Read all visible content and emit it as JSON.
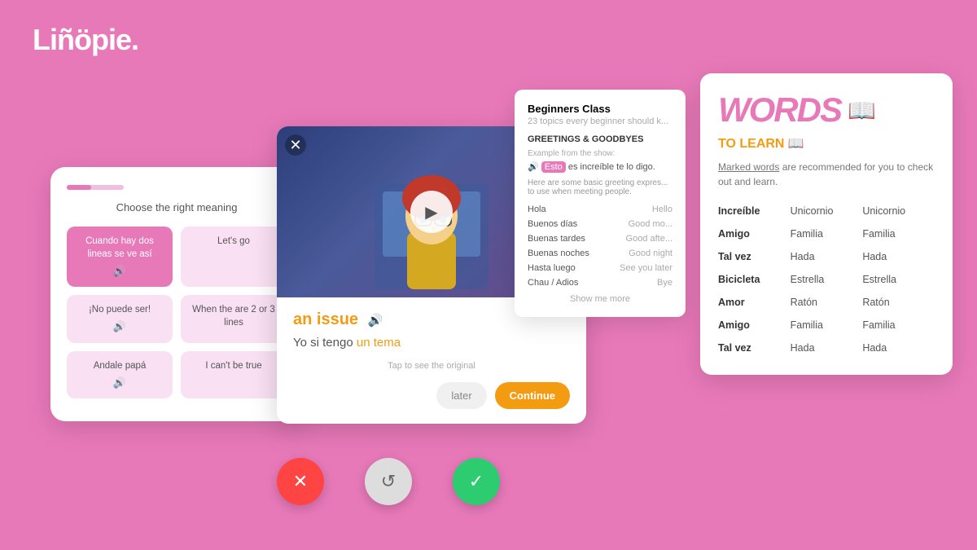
{
  "logo": {
    "text": "Liñöpie."
  },
  "quiz_card": {
    "title": "Choose the right meaning",
    "options": [
      {
        "text": "Cuando hay dos lineas se ve así",
        "highlight": true
      },
      {
        "text": "Let's go",
        "highlight": false
      },
      {
        "text": "¡No puede ser!",
        "highlight": false
      },
      {
        "text": "When the are 2 or 3 lines",
        "highlight": false
      },
      {
        "text": "Andale papá",
        "highlight": false
      },
      {
        "text": "I can't be true",
        "highlight": false
      }
    ]
  },
  "video_card": {
    "phrase": "an issue",
    "translation": "Yo si tengo",
    "translation_highlight": "un tema",
    "tap_text": "Tap to see the original",
    "btn_later": "later",
    "btn_continue": "Continue"
  },
  "vocab_list": {
    "title": "Beginners Class",
    "subtitle": "23 topics every beginner should k...",
    "section": "GREETINGS & GOODBYES",
    "example_label": "Example from the show:",
    "sentence_plain": "es increíble te lo digo.",
    "sentence_highlight": "Esto",
    "desc": "Here are some basic greeting expres... to use when meeting people.",
    "pairs": [
      {
        "es": "Hola",
        "en": "Hello"
      },
      {
        "es": "Buenos días",
        "en": "Good mo..."
      },
      {
        "es": "Buenas tardes",
        "en": "Good afte..."
      },
      {
        "es": "Buenas noches",
        "en": "Good night"
      },
      {
        "es": "Hasta luego",
        "en": "See you later"
      },
      {
        "es": "Chau / Adios",
        "en": "Bye"
      }
    ],
    "more": "Show me more"
  },
  "words_card": {
    "title_words": "WORDS",
    "subtitle": "TO LEARN 📖",
    "desc_marked": "Marked words",
    "desc_rest": " are recommended for you to check out and learn.",
    "grid": [
      [
        "Increíble",
        "Unicornio",
        "Unicornio"
      ],
      [
        "Amigo",
        "Familia",
        "Familia"
      ],
      [
        "Tal vez",
        "Hada",
        "Hada"
      ],
      [
        "Bicicleta",
        "Estrella",
        "Estrella"
      ],
      [
        "Amor",
        "Ratón",
        "Ratón"
      ],
      [
        "Amigo",
        "Familia",
        "Familia"
      ],
      [
        "Tal vez",
        "Hada",
        "Hada"
      ]
    ]
  },
  "bottom_circles": {
    "reject": "✕",
    "retry": "↺",
    "accept": "✓"
  },
  "colors": {
    "brand_pink": "#e879b9",
    "brand_orange": "#f39c12",
    "background": "#e879b9"
  }
}
